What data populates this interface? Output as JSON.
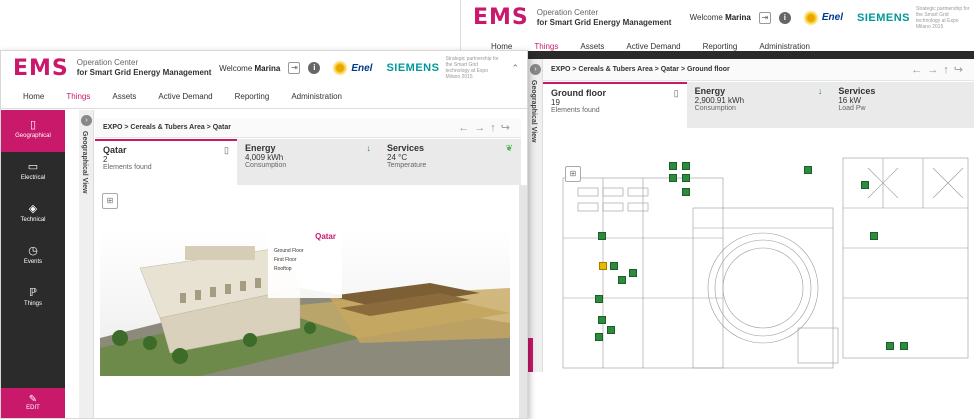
{
  "back": {
    "logo": "EMS",
    "operation_line1": "Operation Center",
    "operation_line2": "for Smart Grid Energy Management",
    "welcome": "Welcome",
    "user": "Marina",
    "enel": "Enel",
    "siemens": "SIEMENS",
    "partnership": "Strategic partnership for the Smart Grid technology at Expo Milano 2015",
    "nav": [
      "Home",
      "Things",
      "Assets",
      "Active Demand",
      "Reporting",
      "Administration"
    ],
    "active_nav": "Things",
    "geo_label": "Geographical View",
    "breadcrumb": "EXPO > Cereals & Tubers Area > Qatar > Ground floor",
    "kpis": [
      {
        "title": "Ground floor",
        "value": "19",
        "sub": "Elements found",
        "icon": "map-icon"
      },
      {
        "title": "Energy",
        "value": "2,900.91 kWh",
        "sub": "Consumption",
        "icon": "arrow-down-icon"
      },
      {
        "title": "Services",
        "value": "16 kW",
        "sub": "Load Pw",
        "icon": "leaf-icon"
      }
    ]
  },
  "front": {
    "logo": "EMS",
    "operation_line1": "Operation Center",
    "operation_line2": "for Smart Grid Energy Management",
    "welcome": "Welcome",
    "user": "Marina",
    "enel": "Enel",
    "siemens": "SIEMENS",
    "partnership": "Strategic partnership for the Smart Grid technology at Expo Milano 2015",
    "nav": [
      "Home",
      "Things",
      "Assets",
      "Active Demand",
      "Reporting",
      "Administration"
    ],
    "active_nav": "Things",
    "sidebar": [
      {
        "label": "Geographical",
        "icon": "map-icon"
      },
      {
        "label": "Electrical",
        "icon": "battery-icon"
      },
      {
        "label": "Technical",
        "icon": "layers-icon"
      },
      {
        "label": "Events",
        "icon": "clock-icon"
      },
      {
        "label": "Things",
        "icon": "plug-icon"
      }
    ],
    "edit": "EDIT",
    "geo_label": "Geographical View",
    "breadcrumb": "EXPO > Cereals & Tubers Area > Qatar",
    "kpis": [
      {
        "title": "Qatar",
        "value": "2",
        "sub": "Elements found",
        "icon": "map-icon"
      },
      {
        "title": "Energy",
        "value": "4,009 kWh",
        "sub": "Consumption",
        "icon": "arrow-down-icon"
      },
      {
        "title": "Services",
        "value": "24 °C",
        "sub": "Temperature",
        "icon": "leaf-icon"
      }
    ],
    "popup": {
      "title": "Qatar",
      "items": [
        "Ground Floor",
        "First Floor",
        "Rooftop"
      ]
    }
  },
  "colors": {
    "accent": "#c8196b",
    "sidebar": "#2b2b2b",
    "green": "#2e8b3e",
    "enel_blue": "#003a8c",
    "siemens": "#00999a"
  }
}
